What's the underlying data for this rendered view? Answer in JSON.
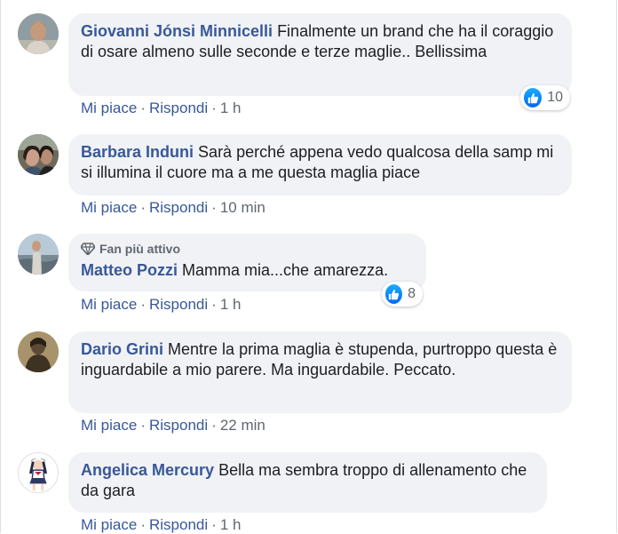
{
  "comments": [
    {
      "author": "Giovanni Jónsi Minnicelli",
      "text": "Finalmente un brand che ha il coraggio di osare almeno sulle seconde e terze maglie.. Bellissima",
      "like_label": "Mi piace",
      "reply_label": "Rispondi",
      "time": "1 h",
      "reactions": "10"
    },
    {
      "author": "Barbara Induni",
      "text": "Sarà perché appena vedo qualcosa della samp mi si illumina il cuore ma a me questa maglia piace",
      "like_label": "Mi piace",
      "reply_label": "Rispondi",
      "time": "10 min"
    },
    {
      "badge": "Fan più attivo",
      "author": "Matteo Pozzi",
      "text": "Mamma mia...che amarezza.",
      "like_label": "Mi piace",
      "reply_label": "Rispondi",
      "time": "1 h",
      "reactions": "8"
    },
    {
      "author": "Dario Grini",
      "text": "Mentre la prima maglia è stupenda, purtroppo questa è inguardabile a mio parere. Ma inguardabile. Peccato.",
      "like_label": "Mi piace",
      "reply_label": "Rispondi",
      "time": "22 min"
    },
    {
      "author": "Angelica Mercury",
      "text": "Bella ma sembra troppo di allenamento che da gara",
      "like_label": "Mi piace",
      "reply_label": "Rispondi",
      "time": "1 h"
    }
  ],
  "separator": "·",
  "colors": {
    "link": "#385898",
    "bubble": "#f0f2f5",
    "muted": "#606770",
    "like_blue": "#1877f2"
  },
  "icons": {
    "badge": "diamond-icon",
    "reaction": "thumbs-up-icon"
  }
}
